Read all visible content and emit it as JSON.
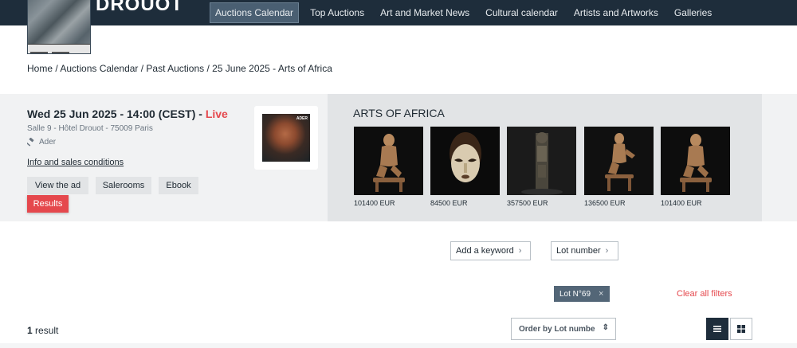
{
  "header": {
    "logo_text": "DROUOT",
    "nav": [
      {
        "label": "Auctions Calendar",
        "active": true
      },
      {
        "label": "Top Auctions"
      },
      {
        "label": "Art and Market News"
      },
      {
        "label": "Cultural calendar"
      },
      {
        "label": "Artists and Artworks"
      },
      {
        "label": "Galleries"
      }
    ]
  },
  "breadcrumb": "Home / Auctions Calendar / Past Auctions / 25 June 2025 - Arts of Africa",
  "sale": {
    "date": "Wed 25 Jun 2025 - 14:00 (CEST) - ",
    "status": "Live",
    "location": "Salle 9 - Hôtel Drouot - 75009 Paris",
    "auction_house": "Ader",
    "info_link": "Info and sales conditions",
    "buttons": {
      "view_ad": "View the ad",
      "salerooms": "Salerooms",
      "ebook": "Ebook",
      "results": "Results"
    },
    "cover_brand": "ADER",
    "title": "ARTS OF AFRICA",
    "lots": [
      {
        "price": "101400 EUR"
      },
      {
        "price": "84500 EUR"
      },
      {
        "price": "357500 EUR"
      },
      {
        "price": "136500 EUR"
      },
      {
        "price": "101400 EUR"
      }
    ]
  },
  "filters": {
    "keyword_label": "Add a keyword",
    "lot_number_label": "Lot number",
    "active_chip": "Lot N°69",
    "clear_all": "Clear all filters"
  },
  "results": {
    "count": "1",
    "label": " result",
    "order_by": "Order by Lot numbe"
  },
  "colors": {
    "nav_bg": "#1e2d3b",
    "accent_red": "#e5484d",
    "chip_bg": "#536677"
  }
}
